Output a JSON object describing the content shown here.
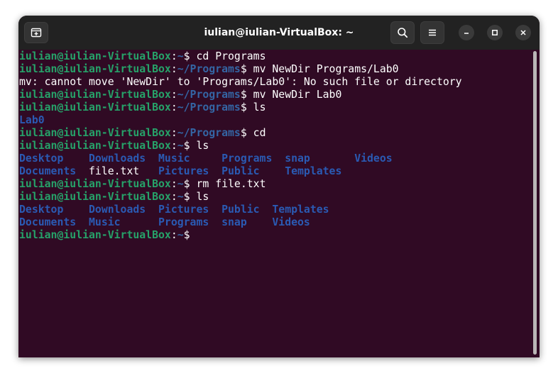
{
  "window": {
    "title": "iulian@iulian-VirtualBox: ~"
  },
  "icons": {
    "new_tab": "new-tab-icon",
    "search": "search-icon",
    "menu": "hamburger-menu-icon",
    "minimize": "minimize-icon",
    "maximize": "maximize-icon",
    "close": "close-icon"
  },
  "colors": {
    "terminal_bg": "#300a24",
    "titlebar_bg": "#222222",
    "prompt_user": "#26a269",
    "prompt_path": "#3465a4",
    "directory": "#2a5ab3",
    "text": "#ffffff"
  },
  "terminal": {
    "prompt_user": "iulian@iulian-VirtualBox",
    "lines": [
      {
        "path": "~",
        "command": " cd Programs"
      },
      {
        "path": "~/Programs",
        "command": " mv NewDir Programs/Lab0"
      },
      {
        "output": "mv: cannot move 'NewDir' to 'Programs/Lab0': No such file or directory"
      },
      {
        "path": "~/Programs",
        "command": " mv NewDir Lab0"
      },
      {
        "path": "~/Programs",
        "command": " ls"
      },
      {
        "ls": [
          {
            "text": "Lab0",
            "dir": true
          }
        ]
      },
      {
        "path": "~/Programs",
        "command": " cd"
      },
      {
        "path": "~",
        "command": " ls"
      },
      {
        "ls": [
          {
            "text": "Desktop    ",
            "dir": true
          },
          {
            "text": "Downloads  ",
            "dir": true
          },
          {
            "text": "Music     ",
            "dir": true
          },
          {
            "text": "Programs  ",
            "dir": true
          },
          {
            "text": "snap       ",
            "dir": true
          },
          {
            "text": "Videos",
            "dir": true
          }
        ]
      },
      {
        "ls": [
          {
            "text": "Documents  ",
            "dir": true
          },
          {
            "text": "file.txt   ",
            "dir": false
          },
          {
            "text": "Pictures  ",
            "dir": true
          },
          {
            "text": "Public    ",
            "dir": true
          },
          {
            "text": "Templates",
            "dir": true
          }
        ]
      },
      {
        "path": "~",
        "command": " rm file.txt"
      },
      {
        "path": "~",
        "command": " ls"
      },
      {
        "ls": [
          {
            "text": "Desktop    ",
            "dir": true
          },
          {
            "text": "Downloads  ",
            "dir": true
          },
          {
            "text": "Pictures  ",
            "dir": true
          },
          {
            "text": "Public  ",
            "dir": true
          },
          {
            "text": "Templates",
            "dir": true
          }
        ]
      },
      {
        "ls": [
          {
            "text": "Documents  ",
            "dir": true
          },
          {
            "text": "Music      ",
            "dir": true
          },
          {
            "text": "Programs  ",
            "dir": true
          },
          {
            "text": "snap    ",
            "dir": true
          },
          {
            "text": "Videos",
            "dir": true
          }
        ]
      },
      {
        "path": "~",
        "command": ""
      }
    ]
  }
}
